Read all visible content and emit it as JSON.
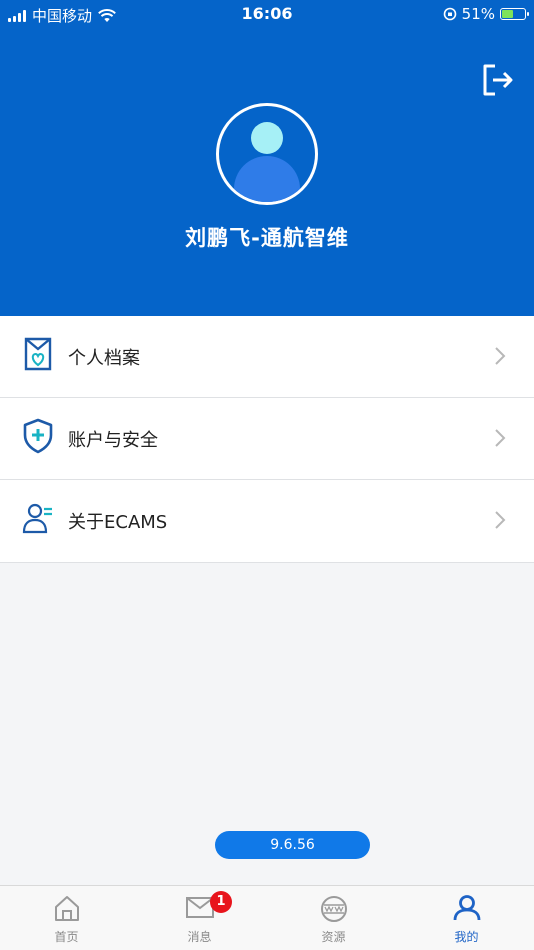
{
  "status_bar": {
    "carrier": "中国移动",
    "time": "16:06",
    "battery_percent": "51%",
    "battery_level": 0.51
  },
  "header": {
    "user_name": "刘鹏飞-通航智维",
    "logout_icon": "logout-icon"
  },
  "menu": {
    "items": [
      {
        "label": "个人档案",
        "icon": "profile-archive-icon"
      },
      {
        "label": "账户与安全",
        "icon": "shield-plus-icon"
      },
      {
        "label": "关于ECAMS",
        "icon": "about-user-icon"
      }
    ]
  },
  "version": "9.6.56",
  "tabbar": {
    "tabs": [
      {
        "label": "首页",
        "icon": "home-icon",
        "active": false
      },
      {
        "label": "消息",
        "icon": "mail-icon",
        "active": false,
        "badge": "1"
      },
      {
        "label": "资源",
        "icon": "www-globe-icon",
        "active": false
      },
      {
        "label": "我的",
        "icon": "user-icon",
        "active": true
      }
    ]
  },
  "colors": {
    "header_bg": "#0564c9",
    "accent": "#1e63c6",
    "badge": "#e8141c",
    "version_pill": "#1079e8"
  }
}
